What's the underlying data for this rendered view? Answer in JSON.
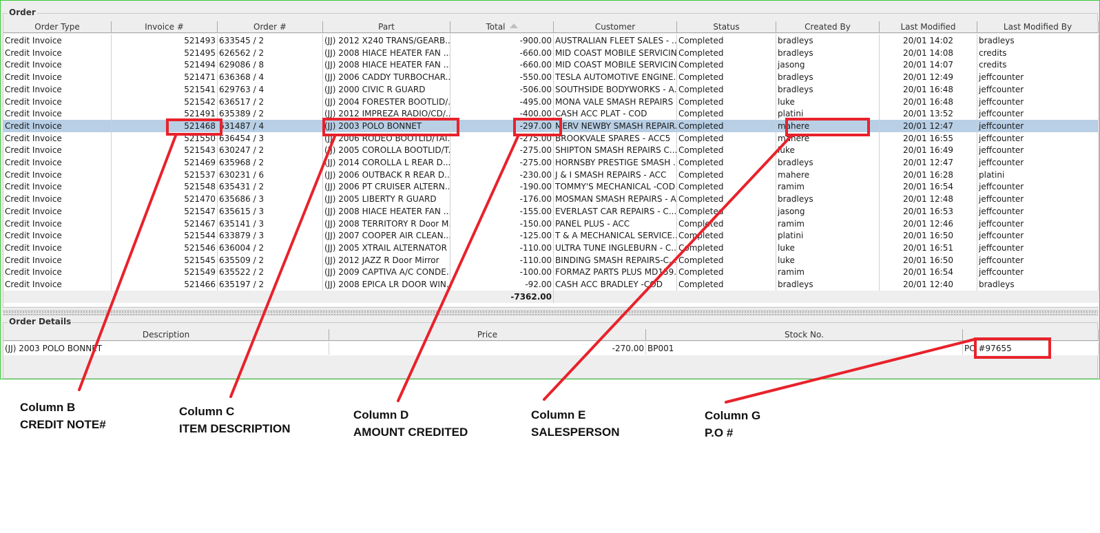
{
  "order_panel": {
    "title": "Order",
    "columns": [
      "Order Type",
      "Invoice #",
      "Order #",
      "Part",
      "Total",
      "Customer",
      "Status",
      "Created By",
      "Last Modified",
      "Last Modified By"
    ],
    "sort_icon": "sort-ascending-icon",
    "rows": [
      [
        "Credit Invoice",
        "521493",
        "633545 / 2",
        "(JJ) 2012 X240 TRANS/GEARB...",
        "-900.00",
        "AUSTRALIAN FLEET SALES - ...",
        "Completed",
        "bradleys",
        "20/01 14:02",
        "bradleys"
      ],
      [
        "Credit Invoice",
        "521495",
        "626562 / 2",
        "(JJ) 2008 HIACE HEATER FAN ...",
        "-660.00",
        "MID COAST MOBILE SERVICIN...",
        "Completed",
        "bradleys",
        "20/01 14:08",
        "credits"
      ],
      [
        "Credit Invoice",
        "521494",
        "629086 / 8",
        "(JJ) 2008 HIACE HEATER FAN ...",
        "-660.00",
        "MID COAST MOBILE SERVICIN...",
        "Completed",
        "jasong",
        "20/01 14:07",
        "credits"
      ],
      [
        "Credit Invoice",
        "521471",
        "636368 / 4",
        "(JJ) 2006 CADDY TURBOCHAR...",
        "-550.00",
        "TESLA AUTOMOTIVE ENGINE...",
        "Completed",
        "bradleys",
        "20/01 12:49",
        "jeffcounter"
      ],
      [
        "Credit Invoice",
        "521541",
        "629763 / 4",
        "(JJ) 2000 CIVIC R GUARD",
        "-506.00",
        "SOUTHSIDE BODYWORKS - A...",
        "Completed",
        "bradleys",
        "20/01 16:48",
        "jeffcounter"
      ],
      [
        "Credit Invoice",
        "521542",
        "636517 / 2",
        "(JJ) 2004 FORESTER BOOTLID/...",
        "-495.00",
        "MONA VALE SMASH REPAIRS ...",
        "Completed",
        "luke",
        "20/01 16:48",
        "jeffcounter"
      ],
      [
        "Credit Invoice",
        "521491",
        "635389 / 2",
        "(JJ) 2012 IMPREZA RADIO/CD/...",
        "-400.00",
        "CASH ACC PLAT - COD",
        "Completed",
        "platini",
        "20/01 13:52",
        "jeffcounter"
      ],
      [
        "Credit Invoice",
        "521468",
        "631487 / 4",
        "(JJ) 2003 POLO BONNET",
        "-297.00",
        "MERV NEWBY SMASH REPAIR...",
        "Completed",
        "mahere",
        "20/01 12:47",
        "jeffcounter"
      ],
      [
        "Credit Invoice",
        "521550",
        "636454 / 3",
        "(JJ) 2006 RODEO BOOTLID/TAI...",
        "-275.00",
        "BROOKVALE SPARES - ACC5",
        "Completed",
        "mahere",
        "20/01 16:55",
        "jeffcounter"
      ],
      [
        "Credit Invoice",
        "521543",
        "630247 / 2",
        "(JJ) 2005 COROLLA BOOTLID/T...",
        "-275.00",
        "SHIPTON SMASH REPAIRS C...",
        "Completed",
        "luke",
        "20/01 16:49",
        "jeffcounter"
      ],
      [
        "Credit Invoice",
        "521469",
        "635968 / 2",
        "(JJ) 2014 COROLLA L REAR D...",
        "-275.00",
        "HORNSBY PRESTIGE SMASH ...",
        "Completed",
        "bradleys",
        "20/01 12:47",
        "jeffcounter"
      ],
      [
        "Credit Invoice",
        "521537",
        "630231 / 6",
        "(JJ) 2006 OUTBACK R REAR D...",
        "-230.00",
        "J & I SMASH REPAIRS - ACC",
        "Completed",
        "mahere",
        "20/01 16:28",
        "platini"
      ],
      [
        "Credit Invoice",
        "521548",
        "635431 / 2",
        "(JJ) 2006 PT CRUISER ALTERN...",
        "-190.00",
        "TOMMY'S MECHANICAL -COD",
        "Completed",
        "ramim",
        "20/01 16:54",
        "jeffcounter"
      ],
      [
        "Credit Invoice",
        "521470",
        "635686 / 3",
        "(JJ) 2005 LIBERTY R GUARD",
        "-176.00",
        "MOSMAN SMASH REPAIRS - A...",
        "Completed",
        "bradleys",
        "20/01 12:48",
        "jeffcounter"
      ],
      [
        "Credit Invoice",
        "521547",
        "635615 / 3",
        "(JJ) 2008 HIACE HEATER FAN ...",
        "-155.00",
        "EVERLAST CAR REPAIRS - C...",
        "Completed",
        "jasong",
        "20/01 16:53",
        "jeffcounter"
      ],
      [
        "Credit Invoice",
        "521467",
        "635141 / 3",
        "(JJ) 2008 TERRITORY R Door M...",
        "-150.00",
        "PANEL PLUS - ACC",
        "Completed",
        "ramim",
        "20/01 12:46",
        "jeffcounter"
      ],
      [
        "Credit Invoice",
        "521544",
        "633879 / 3",
        "(JJ) 2007 COOPER AIR CLEAN...",
        "-125.00",
        "T & A MECHANICAL SERVICE...",
        "Completed",
        "platini",
        "20/01 16:50",
        "jeffcounter"
      ],
      [
        "Credit Invoice",
        "521546",
        "636004 / 2",
        "(JJ) 2005 XTRAIL ALTERNATOR",
        "-110.00",
        "ULTRA TUNE INGLEBURN - C...",
        "Completed",
        "luke",
        "20/01 16:51",
        "jeffcounter"
      ],
      [
        "Credit Invoice",
        "521545",
        "635509 / 2",
        "(JJ) 2012 JAZZ R Door Mirror",
        "-110.00",
        "BINDING SMASH REPAIRS-C...",
        "Completed",
        "luke",
        "20/01 16:50",
        "jeffcounter"
      ],
      [
        "Credit Invoice",
        "521549",
        "635522 / 2",
        "(JJ) 2009 CAPTIVA A/C CONDE...",
        "-100.00",
        "FORMAZ PARTS PLUS MD159...",
        "Completed",
        "ramim",
        "20/01 16:54",
        "jeffcounter"
      ],
      [
        "Credit Invoice",
        "521466",
        "635197 / 2",
        "(JJ) 2008 EPICA LR DOOR WIN...",
        "-92.00",
        "CASH ACC BRADLEY -COD",
        "Completed",
        "bradleys",
        "20/01 12:40",
        "bradleys"
      ]
    ],
    "selected_row_index": 7,
    "total_sum": "-7362.00"
  },
  "details_panel": {
    "title": "Order Details",
    "columns": [
      "Description",
      "Price",
      "Stock No.",
      ""
    ],
    "row": [
      "(JJ) 2003 POLO BONNET",
      "-270.00",
      "BP001",
      "PO #97655"
    ]
  },
  "annotations": {
    "highlight_color": "#e8222b",
    "captions": [
      {
        "line1": "Column B",
        "line2": "CREDIT NOTE#"
      },
      {
        "line1": "Column C",
        "line2": "ITEM DESCRIPTION"
      },
      {
        "line1": "Column D",
        "line2": "AMOUNT CREDITED"
      },
      {
        "line1": "Column E",
        "line2": "SALESPERSON"
      },
      {
        "line1": "Column G",
        "line2": "P.O #"
      }
    ]
  }
}
